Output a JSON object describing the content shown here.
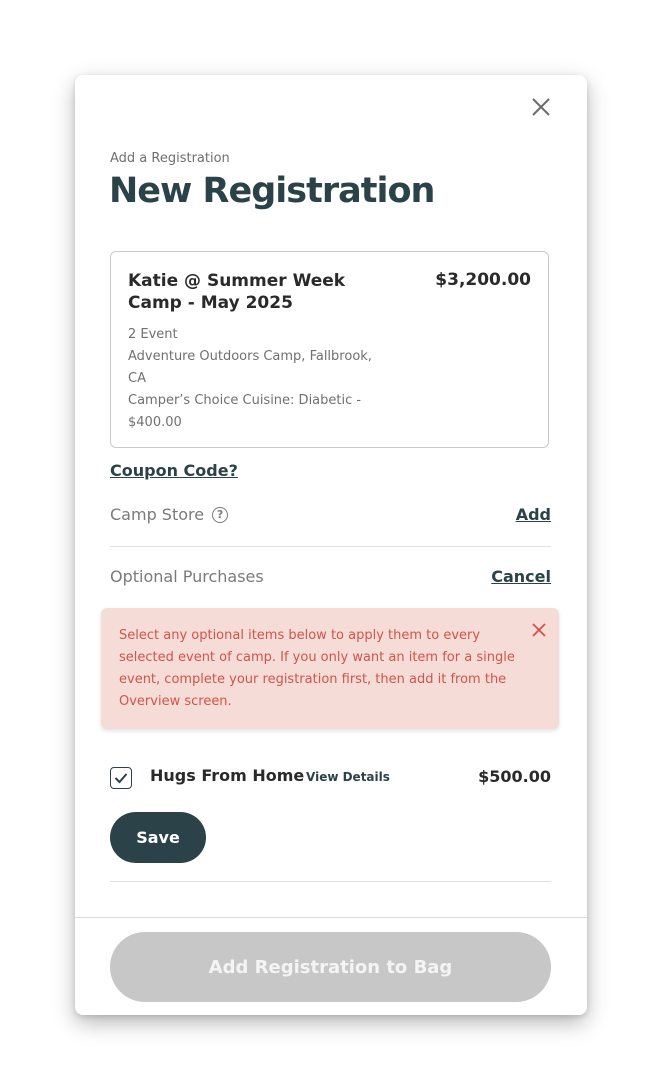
{
  "modal": {
    "eyebrow": "Add a Registration",
    "title": "New Registration",
    "close_icon": "close-icon"
  },
  "registration": {
    "name": "Katie @ Summer Week Camp - May 2025",
    "price": "$3,200.00",
    "details": [
      "2 Event",
      "Adventure Outdoors Camp, Fallbrook, CA",
      "Camper’s Choice Cuisine: Diabetic - $400.00"
    ]
  },
  "coupon_label": "Coupon Code?",
  "camp_store": {
    "label": "Camp Store",
    "help_icon": "question-circle-icon",
    "action": "Add"
  },
  "optional_purchases": {
    "label": "Optional Purchases",
    "action": "Cancel"
  },
  "alert": {
    "text": "Select any optional items below to apply them to every selected event of camp. If you only want an item for a single event, complete your registration first, then add it from the Overview screen.",
    "color": "#d2544a",
    "background": "#f5dcd7",
    "close_icon": "close-icon"
  },
  "optional_item": {
    "checked": true,
    "name": "Hugs From Home",
    "link": "View Details",
    "price": "$500.00"
  },
  "save_label": "Save",
  "add_to_bag_label": "Add Registration to Bag",
  "colors": {
    "brand": "#2b4248",
    "disabled_button": "#c7c7c7"
  }
}
